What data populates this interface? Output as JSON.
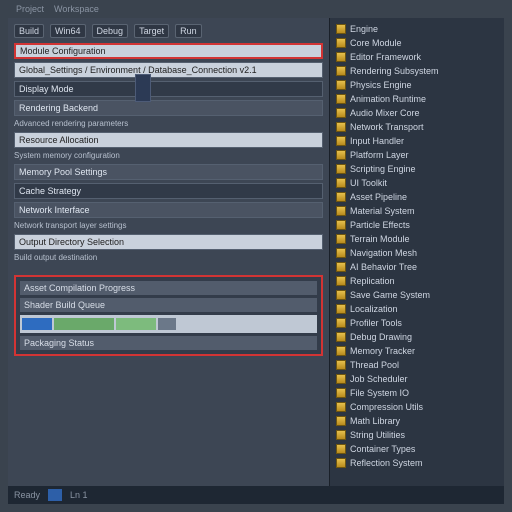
{
  "menu": [
    "Project",
    "Workspace"
  ],
  "toolbar": [
    "Build",
    "Win64",
    "Debug",
    "Target",
    "Run"
  ],
  "panels": [
    "Module Configuration",
    "Global_Settings / Environment / Database_Connection v2.1",
    "Display Mode",
    "Rendering Backend",
    "Resource Allocation",
    "Memory Pool Settings",
    "Cache Strategy",
    "Network Interface",
    "Output Directory Selection"
  ],
  "labels": [
    "Advanced rendering parameters",
    "System memory configuration",
    "Network transport layer settings",
    "Build output destination"
  ],
  "section": {
    "rows": [
      "Asset Compilation Progress",
      "Shader Build Queue",
      "Packaging Status"
    ]
  },
  "tree": [
    "Engine",
    "Core Module",
    "Editor Framework",
    "Rendering Subsystem",
    "Physics Engine",
    "Animation Runtime",
    "Audio Mixer Core",
    "Network Transport",
    "Input Handler",
    "Platform Layer",
    "Scripting Engine",
    "UI Toolkit",
    "Asset Pipeline",
    "Material System",
    "Particle Effects",
    "Terrain Module",
    "Navigation Mesh",
    "AI Behavior Tree",
    "Replication",
    "Save Game System",
    "Localization",
    "Profiler Tools",
    "Debug Drawing",
    "Memory Tracker",
    "Thread Pool",
    "Job Scheduler",
    "File System IO",
    "Compression Utils",
    "Math Library",
    "String Utilities",
    "Container Types",
    "Reflection System"
  ],
  "status": {
    "left": "Ready",
    "mode": "Ln 1"
  }
}
